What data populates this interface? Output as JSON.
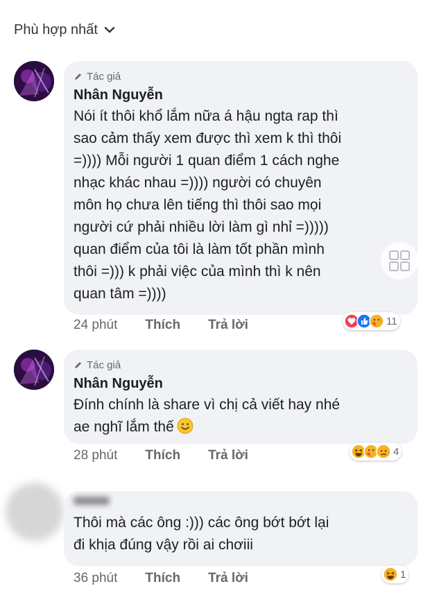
{
  "sort": {
    "label": "Phù hợp nhất",
    "icon": "chevron-down-icon"
  },
  "comments": [
    {
      "badge": "Tác giả",
      "author": "Nhân Nguyễn",
      "lines": [
        "Nói ít thôi khổ lắm nữa á hậu ngta rap thì",
        "sao cảm thấy xem được thì xem k thì thôi",
        "=)))) Mỗi người 1 quan điểm 1 cách nghe",
        "nhạc khác nhau =)))) người có chuyên",
        "môn họ chưa lên tiếng thì thôi sao mọi",
        "người cứ phải nhiều lời làm gì nhỉ =)))))",
        "quan điểm của tôi là làm tốt phần mình",
        "thôi =))) k phải việc của mình thì k nên",
        "quan tâm =))))"
      ],
      "time": "24 phút",
      "like": "Thích",
      "reply": "Trả lời",
      "reaction_count": "11",
      "reactions": [
        "love",
        "like",
        "care"
      ]
    },
    {
      "badge": "Tác giả",
      "author": "Nhân Nguyễn",
      "lines": [
        "Đính chính là share vì chị cả viết hay nhé",
        "ae nghĩ lắm thế"
      ],
      "emoji": "smile-emoji",
      "time": "28 phút",
      "like": "Thích",
      "reply": "Trả lời",
      "reaction_count": "4",
      "reactions": [
        "haha",
        "care",
        "sad"
      ]
    },
    {
      "lines": [
        "Thôi mà các ông :))) các ông bớt bớt lại",
        "đi khịa đúng vậy rồi ai chơiii"
      ],
      "time": "36 phút",
      "like": "Thích",
      "reply": "Trả lời",
      "reaction_count": "1",
      "reactions": [
        "haha"
      ]
    }
  ],
  "colors": {
    "bubble": "#f0f2f5",
    "meta": "#65676b",
    "text": "#1c1e21"
  }
}
